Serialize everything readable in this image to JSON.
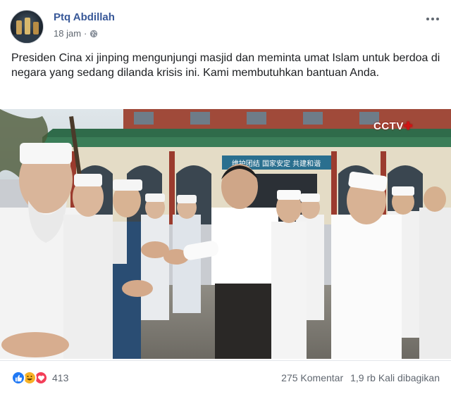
{
  "post": {
    "author": "Ptq Abdillah",
    "time": "18 jam",
    "separator": "·",
    "privacy_icon": "globe-icon",
    "text": "Presiden Cina xi jinping mengunjungi masjid dan meminta umat Islam untuk berdoa di negara yang sedang dilanda krisis ini. Kami membutuhkan bantuan Anda."
  },
  "media": {
    "watermark": "CCTV",
    "banner_text": "维护团结 国家安定 共建和谐"
  },
  "footer": {
    "reaction_icons": [
      "like-icon",
      "haha-icon",
      "love-icon"
    ],
    "reaction_count": "413",
    "comments": "275 Komentar",
    "shares": "1,9 rb Kali dibagikan"
  },
  "colors": {
    "author_link": "#385898",
    "like": "#2078f4",
    "haha": "#f7b125",
    "love": "#f33e58",
    "watermark_red": "#d01414"
  }
}
